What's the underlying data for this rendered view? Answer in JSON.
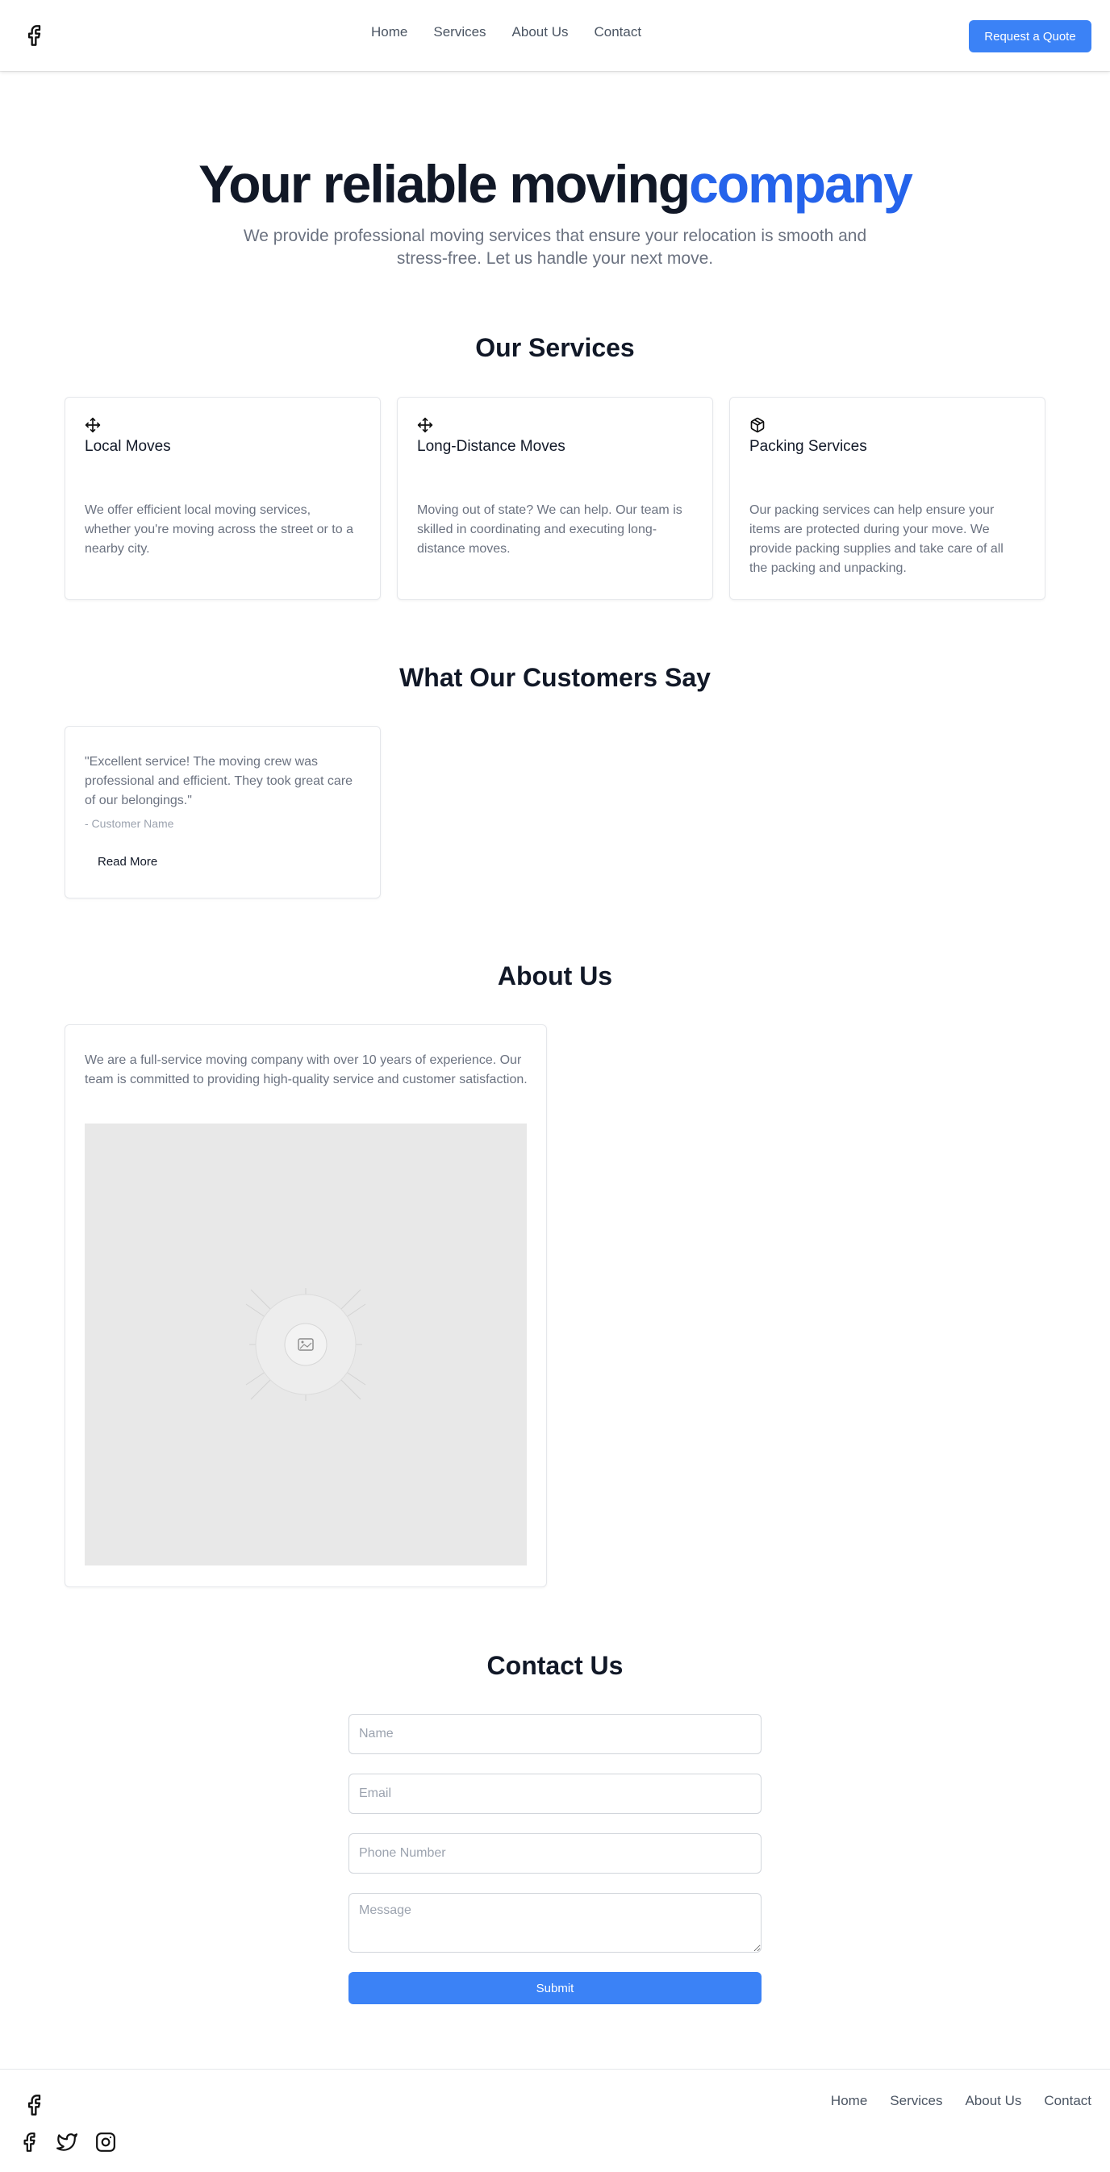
{
  "header": {
    "logo_icon": "facebook-icon",
    "nav": [
      "Home",
      "Services",
      "About Us",
      "Contact"
    ],
    "cta_label": "Request a Quote"
  },
  "hero": {
    "title_main": "Your reliable moving",
    "title_accent": "company",
    "subtitle": "We provide professional moving services that ensure your relocation is smooth and stress-free. Let us handle your next move."
  },
  "services": {
    "title": "Our Services",
    "items": [
      {
        "icon": "move-icon",
        "title": "Local Moves",
        "description": "We offer efficient local moving services, whether you're moving across the street or to a nearby city."
      },
      {
        "icon": "move-icon",
        "title": "Long-Distance Moves",
        "description": "Moving out of state? We can help. Our team is skilled in coordinating and executing long-distance moves."
      },
      {
        "icon": "package-icon",
        "title": "Packing Services",
        "description": "Our packing services can help ensure your items are protected during your move. We provide packing supplies and take care of all the packing and unpacking."
      }
    ]
  },
  "testimonials": {
    "title": "What Our Customers Say",
    "items": [
      {
        "quote": "\"Excellent service! The moving crew was professional and efficient. They took great care of our belongings.\"",
        "author": "- Customer Name",
        "button": "Read More"
      }
    ]
  },
  "about": {
    "title": "About Us",
    "text": "We are a full-service moving company with over 10 years of experience. Our team is committed to providing high-quality service and customer satisfaction.",
    "image_icon": "image-placeholder-icon"
  },
  "contact": {
    "title": "Contact Us",
    "name_placeholder": "Name",
    "email_placeholder": "Email",
    "phone_placeholder": "Phone Number",
    "message_placeholder": "Message",
    "submit_label": "Submit"
  },
  "footer": {
    "logo_icon": "facebook-icon",
    "nav": [
      "Home",
      "Services",
      "About Us",
      "Contact"
    ],
    "social": [
      "facebook-icon",
      "twitter-icon",
      "instagram-icon"
    ]
  },
  "colors": {
    "accent": "#2563eb",
    "button": "#3b82f6",
    "text_dark": "#111827",
    "text_muted": "#6b7280"
  }
}
